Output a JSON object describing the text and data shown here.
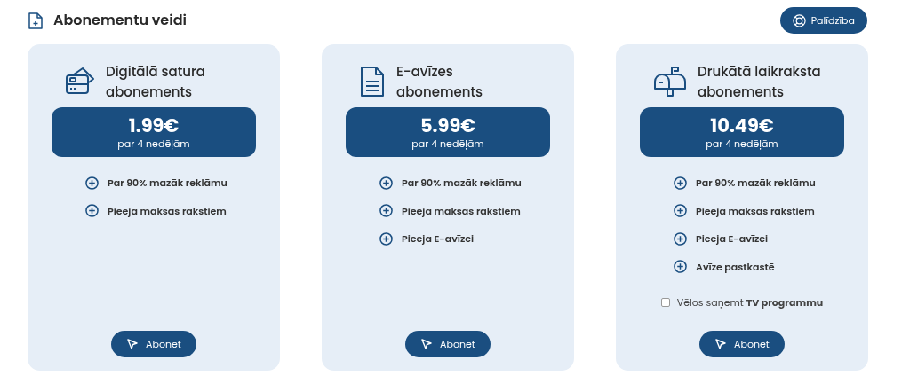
{
  "header": {
    "title": "Abonementu veidi",
    "help_button": "Palīdzība"
  },
  "plans": [
    {
      "kind": "card",
      "title": "Digitālā satura abonements",
      "price": "1.99€",
      "period": "par 4 nedēļām",
      "features": [
        "Par 90% mazāk reklāmu",
        "Pieeja maksas rakstiem"
      ],
      "button": "Abonēt"
    },
    {
      "kind": "newspaper",
      "title": "E-avīzes abonements",
      "price": "5.99€",
      "period": "par 4 nedēļām",
      "features": [
        "Par 90% mazāk reklāmu",
        "Pieeja maksas rakstiem",
        "Pieeja E-avīzei"
      ],
      "button": "Abonēt"
    },
    {
      "kind": "mailbox",
      "title": "Drukātā laikraksta abonements",
      "price": "10.49€",
      "period": "par 4 nedēļām",
      "features": [
        "Par 90% mazāk reklāmu",
        "Pieeja maksas rakstiem",
        "Pieeja E-avīzei",
        "Avīze pastkastē"
      ],
      "option": {
        "label": "Vēlos saņemt **TV programmu**",
        "checked": false
      },
      "button": "Abonēt"
    }
  ]
}
